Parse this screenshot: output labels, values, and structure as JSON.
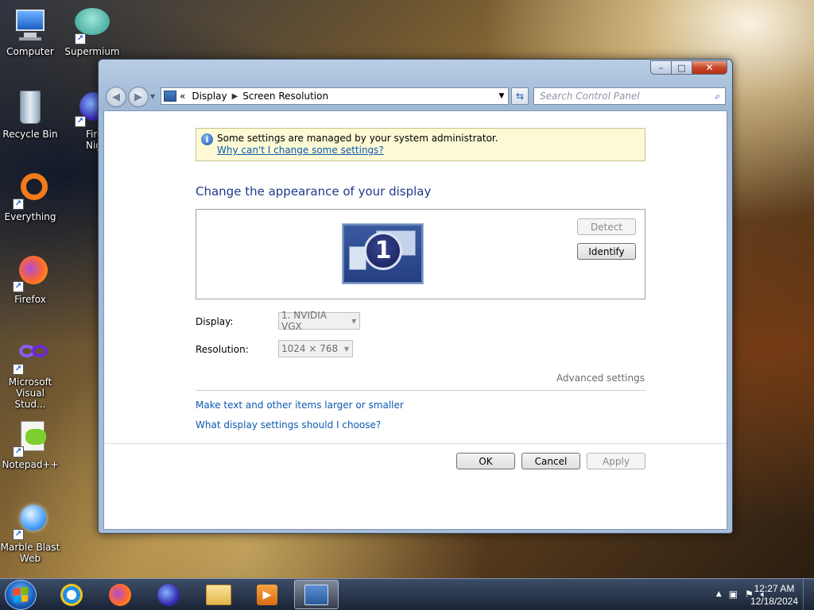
{
  "desktop": {
    "icons": [
      {
        "label": "Computer"
      },
      {
        "label": "Supermium"
      },
      {
        "label": "Recycle Bin"
      },
      {
        "label": "Fire Nigh"
      },
      {
        "label": "Everything"
      },
      {
        "label": "Firefox"
      },
      {
        "label": "Microsoft Visual Stud..."
      },
      {
        "label": "Notepad++"
      },
      {
        "label": "Marble Blast Web"
      }
    ]
  },
  "window": {
    "caption": {
      "minimize": "–",
      "maximize": "□",
      "close": "✕"
    },
    "nav": {
      "back": "◀",
      "forward": "▶"
    },
    "address": {
      "chevron": "«",
      "crumbs": [
        "Display",
        "Screen Resolution"
      ],
      "separator": "▶"
    },
    "search": {
      "placeholder": "Search Control Panel"
    },
    "info": {
      "message": "Some settings are managed by your system administrator.",
      "link": "Why can't I change some settings?"
    },
    "heading": "Change the appearance of your display",
    "monitor": {
      "number": "1"
    },
    "buttons": {
      "detect": "Detect",
      "identify": "Identify",
      "ok": "OK",
      "cancel": "Cancel",
      "apply": "Apply"
    },
    "display": {
      "label": "Display:",
      "value": "1. NVIDIA VGX"
    },
    "resolution": {
      "label": "Resolution:",
      "value": "1024 × 768"
    },
    "advanced": "Advanced settings",
    "links": {
      "larger_text": "Make text and other items larger or smaller",
      "which_settings": "What display settings should I choose?"
    }
  },
  "taskbar": {
    "clock_time": "12:27 AM",
    "clock_date": "12/18/2024",
    "tray": {
      "chevron": "▲"
    }
  },
  "colors": {
    "link": "#0b5ab0",
    "heading": "#1e3a8a",
    "info_bg": "#fcf9d4",
    "close_red": "#c84628"
  }
}
